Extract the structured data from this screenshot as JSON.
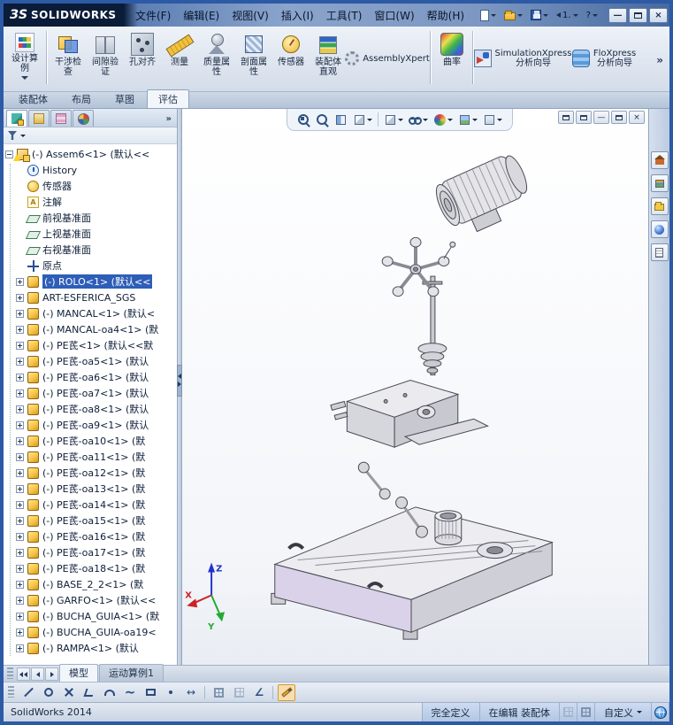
{
  "titlebar": {
    "logo_mark": "ЗS",
    "logo_text": "SOLIDWORKS",
    "menus": [
      "文件(F)",
      "编辑(E)",
      "视图(V)",
      "插入(I)",
      "工具(T)",
      "窗口(W)",
      "帮助(H)"
    ],
    "quick": {
      "undo_label": "1.",
      "help_label": "?"
    },
    "window_buttons": {
      "minimize": "—",
      "close": "×"
    }
  },
  "ribbon": {
    "design_study": {
      "lines": [
        "设计算",
        "例"
      ]
    },
    "buttons": [
      {
        "id": "interference-check",
        "lines": [
          "干涉检",
          "查"
        ]
      },
      {
        "id": "clearance-verification",
        "lines": [
          "间隙验",
          "证"
        ]
      },
      {
        "id": "hole-alignment",
        "lines": [
          "孔对齐",
          ""
        ]
      },
      {
        "id": "measure",
        "lines": [
          "测量",
          ""
        ]
      },
      {
        "id": "mass-properties",
        "lines": [
          "质量属",
          "性"
        ]
      },
      {
        "id": "section-properties",
        "lines": [
          "剖面属",
          "性"
        ]
      },
      {
        "id": "sensors",
        "lines": [
          "传感器",
          ""
        ]
      },
      {
        "id": "assembly-visualization",
        "lines": [
          "装配体",
          "直观"
        ]
      }
    ],
    "assemblyxpert_label": "AssemblyXpert",
    "curvature_label": "曲率",
    "simulationxpress": {
      "lines": [
        "SimulationXpress",
        "分析向导"
      ]
    },
    "floxpress": {
      "lines": [
        "FloXpress",
        "分析向导"
      ]
    },
    "overflow": "»"
  },
  "command_tabs": {
    "items": [
      "装配体",
      "布局",
      "草图",
      "评估"
    ],
    "active": "评估"
  },
  "panel": {
    "flyout": "»"
  },
  "feature_tree": {
    "items": [
      {
        "text": "(-) Assem6<1> (默认<<"
      },
      {
        "text": "History"
      },
      {
        "text": "传感器"
      },
      {
        "text": "注解"
      },
      {
        "text": "前视基准面"
      },
      {
        "text": "上视基准面"
      },
      {
        "text": "右视基准面"
      },
      {
        "text": "原点"
      },
      {
        "text": "(-) ROLO<1> (默认<<"
      },
      {
        "text": "ART-ESFERICA_SGS"
      },
      {
        "text": "(-) MANCAL<1> (默认<"
      },
      {
        "text": "(-) MANCAL-oa4<1> (默"
      },
      {
        "text": "(-) PE茋<1> (默认<<默"
      },
      {
        "text": "(-) PE茋-oa5<1> (默认"
      },
      {
        "text": "(-) PE茋-oa6<1> (默认"
      },
      {
        "text": "(-) PE茋-oa7<1> (默认"
      },
      {
        "text": "(-) PE茋-oa8<1> (默认"
      },
      {
        "text": "(-) PE茋-oa9<1> (默认"
      },
      {
        "text": "(-) PE茋-oa10<1> (默"
      },
      {
        "text": "(-) PE茋-oa11<1> (默"
      },
      {
        "text": "(-) PE茋-oa12<1> (默"
      },
      {
        "text": "(-) PE茋-oa13<1> (默"
      },
      {
        "text": "(-) PE茋-oa14<1> (默"
      },
      {
        "text": "(-) PE茋-oa15<1> (默"
      },
      {
        "text": "(-) PE茋-oa16<1> (默"
      },
      {
        "text": "(-) PE茋-oa17<1> (默"
      },
      {
        "text": "(-) PE茋-oa18<1> (默"
      },
      {
        "text": "(-) BASE_2_2<1> (默"
      },
      {
        "text": "(-) GARFO<1> (默认<<"
      },
      {
        "text": "(-) BUCHA_GUIA<1> (默"
      },
      {
        "text": "(-) BUCHA_GUIA-oa19<"
      },
      {
        "text": "(-) RAMPA<1> (默认"
      }
    ]
  },
  "graphics": {
    "triad": {
      "x": "X",
      "y": "Y",
      "z": "Z"
    }
  },
  "headsup_icons": [
    "zoom-fit",
    "zoom-to-area",
    "section-view",
    "view-orientation",
    "display-style",
    "hide-show-items",
    "edit-appearance",
    "apply-scene",
    "view-settings"
  ],
  "taskpane_icons": [
    "solidworks-resources",
    "design-library",
    "file-explorer",
    "appearances-scenes",
    "custom-properties"
  ],
  "motion": {
    "tabs": [
      "模型",
      "运动算例1"
    ],
    "active": "模型"
  },
  "sketch_icons": [
    "line",
    "circle",
    "trim",
    "centerline",
    "arc",
    "spline",
    "rectangle",
    "point",
    "smart-dimension",
    "grid",
    "snap",
    "angle",
    "sketch"
  ],
  "statusbar": {
    "app": "SolidWorks 2014",
    "definition": "完全定义",
    "editing": "在编辑 装配体",
    "customize": "自定义"
  }
}
